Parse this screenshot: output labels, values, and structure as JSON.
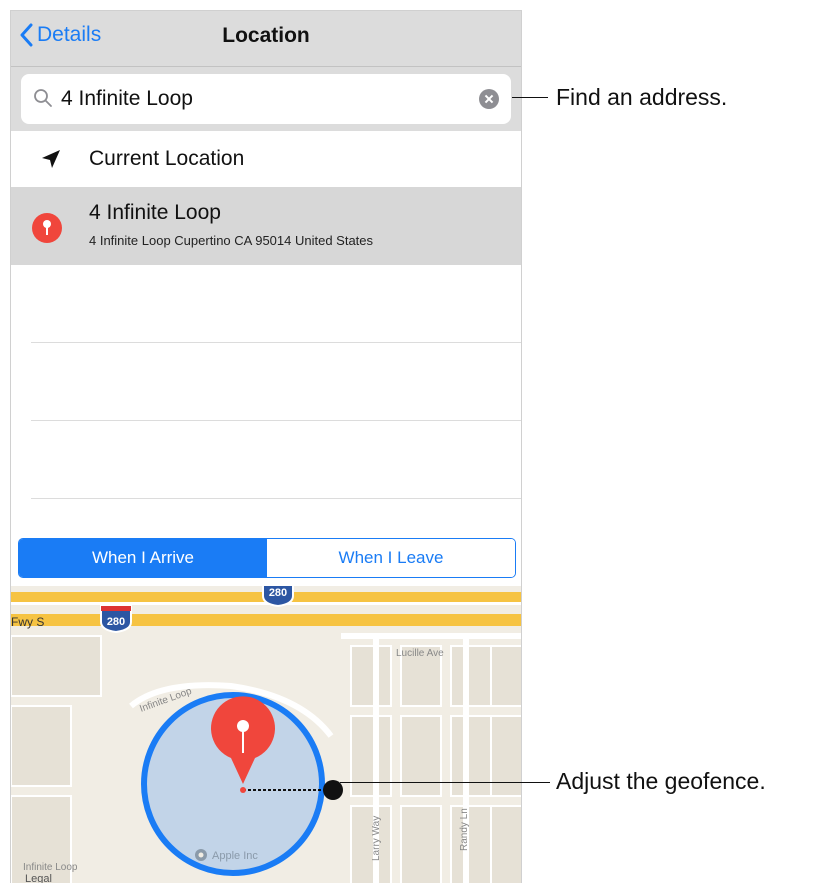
{
  "nav": {
    "back_label": "Details",
    "title": "Location"
  },
  "search": {
    "value": "4 Infinite Loop"
  },
  "rows": {
    "current_location": "Current Location",
    "result_title": "4 Infinite Loop",
    "result_subtitle": "4 Infinite Loop Cupertino CA 95014 United States"
  },
  "segments": {
    "arrive": "When I Arrive",
    "leave": "When I Leave",
    "selected": "arrive"
  },
  "map": {
    "road_280": "280",
    "road_fwy": "Fwy S",
    "lucille": "Lucille Ave",
    "infinite_loop": "Infinite Loop",
    "infinite_loop_2": "Infinite Loop",
    "larry_way": "Larry Way",
    "randy_ln": "Randy Ln",
    "apple_inc": "Apple Inc",
    "legal": "Legal"
  },
  "callouts": {
    "find": "Find an address.",
    "adjust": "Adjust the geofence."
  },
  "colors": {
    "accent": "#1a7cf5",
    "pin": "#f0463c",
    "geofence": "#1a7cf5"
  }
}
